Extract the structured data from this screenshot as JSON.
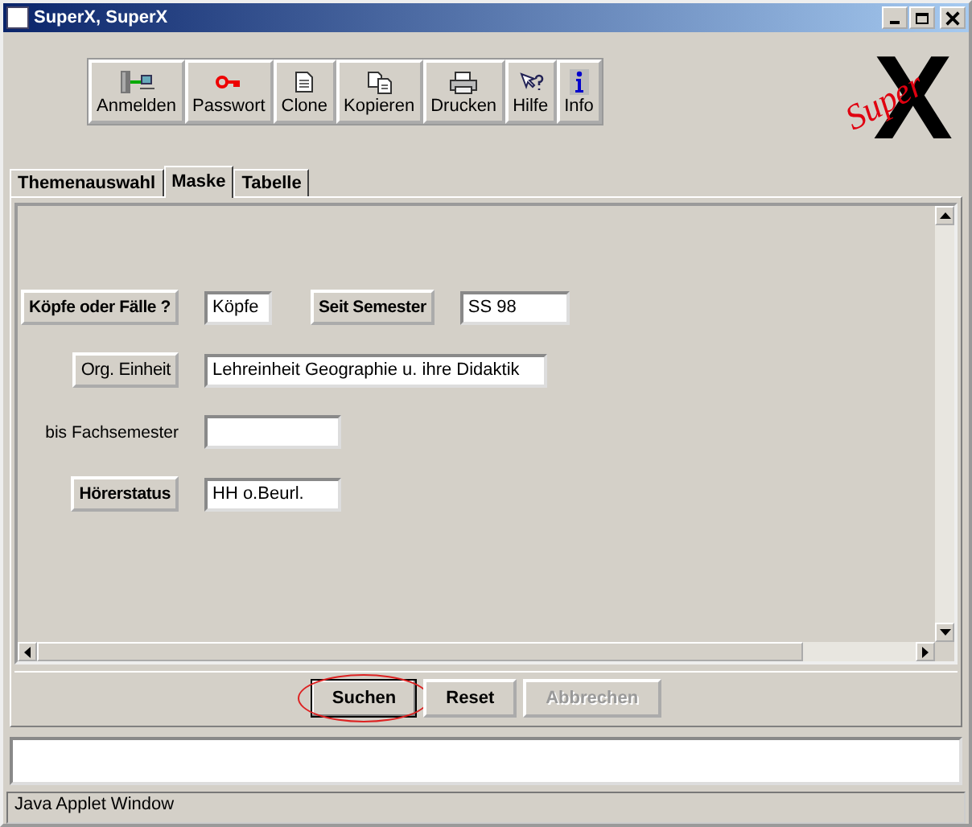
{
  "window": {
    "title": "SuperX, SuperX"
  },
  "toolbar": [
    {
      "kind": "login",
      "label": "Anmelden"
    },
    {
      "kind": "key",
      "label": "Passwort"
    },
    {
      "kind": "doc",
      "label": "Clone"
    },
    {
      "kind": "copy",
      "label": "Kopieren"
    },
    {
      "kind": "print",
      "label": "Drucken"
    },
    {
      "kind": "help",
      "label": "Hilfe"
    },
    {
      "kind": "info",
      "label": "Info"
    }
  ],
  "logo": {
    "script": "Super",
    "mark": "X"
  },
  "tabs": [
    {
      "label": "Themenauswahl",
      "selected": false
    },
    {
      "label": "Maske",
      "selected": true
    },
    {
      "label": "Tabelle",
      "selected": false
    }
  ],
  "form": [
    {
      "label": "Köpfe oder Fälle ?",
      "kind": "button",
      "bold": true,
      "value": "Köpfe",
      "extra": {
        "label": "Seit Semester",
        "value": "SS 98"
      }
    },
    {
      "label": "Org. Einheit",
      "kind": "button",
      "bold": false,
      "value": "Lehreinheit Geographie u. ihre Didaktik"
    },
    {
      "label": "bis Fachsemester",
      "kind": "text"
    },
    {
      "label": "Hörerstatus",
      "kind": "button",
      "bold": true,
      "value": "HH o.Beurl."
    }
  ],
  "actions": [
    {
      "label": "Suchen",
      "disabled": false,
      "highlighted": true
    },
    {
      "label": "Reset",
      "disabled": false,
      "highlighted": false
    },
    {
      "label": "Abbrechen",
      "disabled": true,
      "highlighted": false
    }
  ],
  "status_bar": "Java Applet Window"
}
